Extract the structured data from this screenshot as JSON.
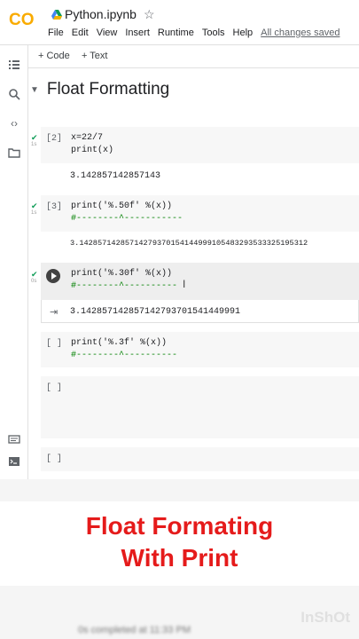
{
  "app": {
    "logo_text": "CO",
    "notebook_title": "Python.ipynb",
    "menu": [
      "File",
      "Edit",
      "View",
      "Insert",
      "Runtime",
      "Tools",
      "Help"
    ],
    "saved_status": "All changes saved"
  },
  "toolbar": {
    "add_code": "+ Code",
    "add_text": "+ Text"
  },
  "section": {
    "title": "Float Formatting"
  },
  "cells": [
    {
      "exec": "[2]",
      "code_line1": "x=22/7",
      "code_line2": "print(x)",
      "output": "3.142857142857143"
    },
    {
      "exec": "[3]",
      "code_line1": "print('%.50f' %(x))",
      "code_line2": "#--------^-----------",
      "output": "3.14285714285714279370154144999105483293533325195312"
    },
    {
      "exec": "",
      "code_line1": "print('%.30f' %(x))",
      "code_line2": "#--------^----------",
      "output": "3.142857142857142793701541449991"
    },
    {
      "exec": "[ ]",
      "code_line1": "print('%.3f' %(x))",
      "code_line2": "#--------^----------"
    },
    {
      "exec": "[ ]"
    },
    {
      "exec": "[ ]"
    }
  ],
  "caption": {
    "line1": "Float Formating",
    "line2": "With Print"
  },
  "status_bar": {
    "text": "0s    completed at 11:33 PM"
  },
  "watermark": "InShOt",
  "colors": {
    "caption": "#e51b1b",
    "logo": "#f9ab00",
    "success": "#0f9d58"
  }
}
